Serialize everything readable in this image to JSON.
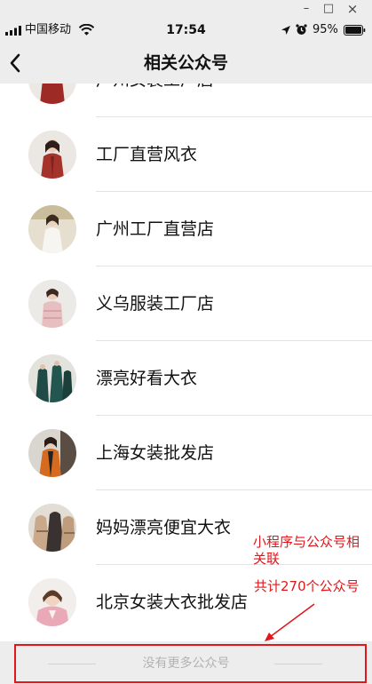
{
  "window_controls": {
    "minimize": "–",
    "maximize": "□",
    "close": "×"
  },
  "status_bar": {
    "carrier": "中国移动",
    "time": "17:54",
    "battery": "95%"
  },
  "nav": {
    "title": "相关公众号"
  },
  "accounts": [
    {
      "name": "广州女装工厂店",
      "avatar": "red-coat"
    },
    {
      "name": "工厂直营风衣",
      "avatar": "red-coat"
    },
    {
      "name": "广州工厂直营店",
      "avatar": "white-dress"
    },
    {
      "name": "义乌服装工厂店",
      "avatar": "pink-vest"
    },
    {
      "name": "漂亮好看大衣",
      "avatar": "green-coats"
    },
    {
      "name": "上海女装批发店",
      "avatar": "orange-coat"
    },
    {
      "name": "妈妈漂亮便宜大衣",
      "avatar": "beige-coats"
    },
    {
      "name": "北京女装大衣批发店",
      "avatar": "pink-jacket"
    }
  ],
  "footer": {
    "text": "没有更多公众号"
  },
  "annotation": {
    "line1": "小程序与公众号相关联",
    "line2": "共计270个公众号",
    "color": "#e0171b"
  }
}
